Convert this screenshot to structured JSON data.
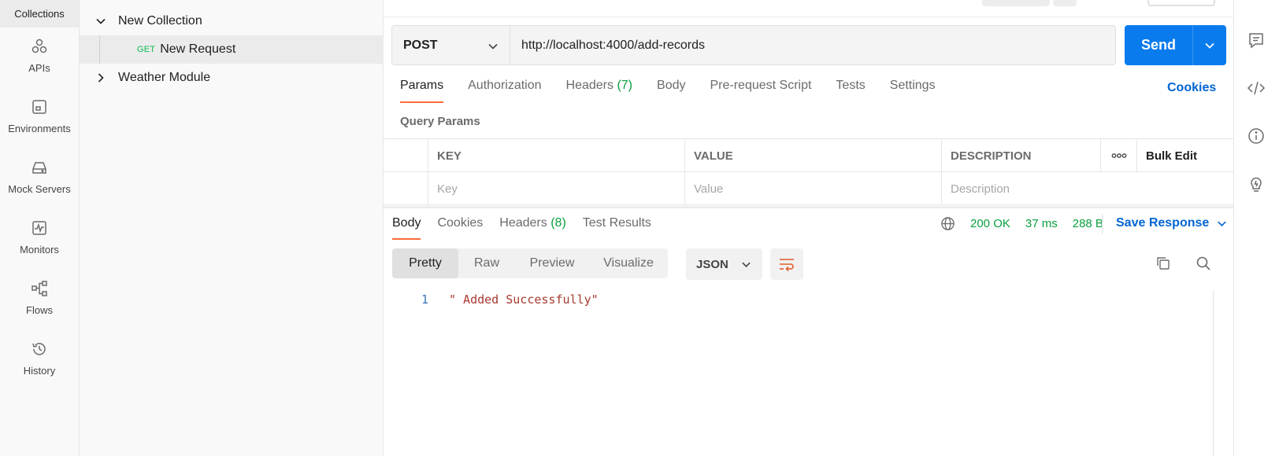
{
  "left_rail": {
    "active_label": "Collections",
    "items": [
      {
        "label": "APIs",
        "icon": "apis-icon"
      },
      {
        "label": "Environments",
        "icon": "environments-icon"
      },
      {
        "label": "Mock Servers",
        "icon": "mock-servers-icon"
      },
      {
        "label": "Monitors",
        "icon": "monitors-icon"
      },
      {
        "label": "Flows",
        "icon": "flows-icon"
      },
      {
        "label": "History",
        "icon": "history-icon"
      }
    ]
  },
  "tree": {
    "collection": "New Collection",
    "request_method": "GET",
    "request_name": "New Request",
    "second_collection": "Weather Module"
  },
  "request": {
    "method": "POST",
    "url": "http://localhost:4000/add-records",
    "send_label": "Send",
    "tabs": [
      {
        "label": "Params",
        "count": ""
      },
      {
        "label": "Authorization",
        "count": ""
      },
      {
        "label": "Headers",
        "count": "(7)"
      },
      {
        "label": "Body",
        "count": ""
      },
      {
        "label": "Pre-request Script",
        "count": ""
      },
      {
        "label": "Tests",
        "count": ""
      },
      {
        "label": "Settings",
        "count": ""
      }
    ],
    "cookies_link": "Cookies",
    "query_params_label": "Query Params",
    "table": {
      "headers": [
        "KEY",
        "VALUE",
        "DESCRIPTION"
      ],
      "bulk_edit": "Bulk Edit",
      "placeholders": [
        "Key",
        "Value",
        "Description"
      ]
    }
  },
  "response": {
    "tabs": [
      {
        "label": "Body",
        "count": ""
      },
      {
        "label": "Cookies",
        "count": ""
      },
      {
        "label": "Headers",
        "count": "(8)"
      },
      {
        "label": "Test Results",
        "count": ""
      }
    ],
    "status": "200 OK",
    "time": "37 ms",
    "size": "288 B",
    "save_label": "Save Response",
    "format_tabs": [
      "Pretty",
      "Raw",
      "Preview",
      "Visualize"
    ],
    "format": "JSON",
    "line_number": "1",
    "body": "\" Added Successfully\""
  },
  "colors": {
    "accent": "#ff6c37",
    "primary": "#097bed",
    "success": "#0a9f3e"
  }
}
